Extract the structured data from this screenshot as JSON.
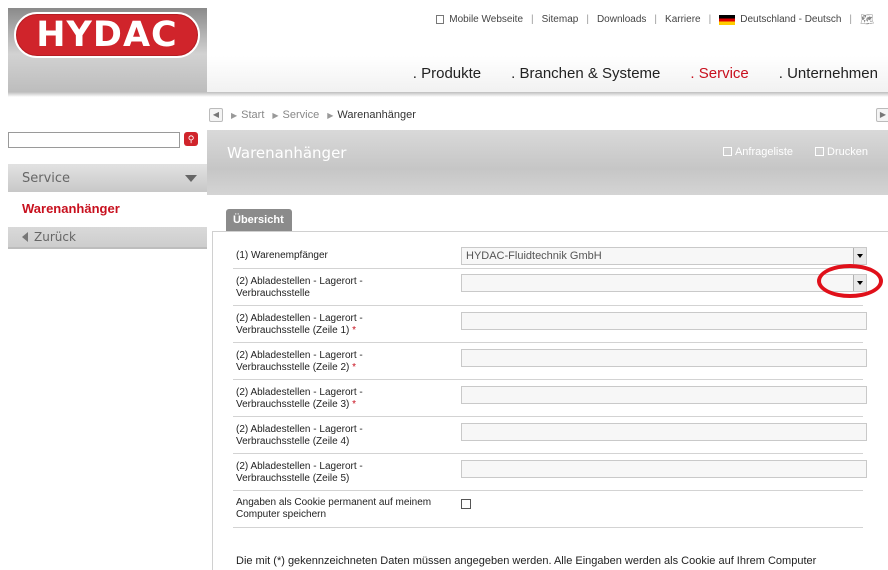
{
  "brand": {
    "logo_text": "HYDAC"
  },
  "topnav": {
    "mobile": "Mobile Webseite",
    "sitemap": "Sitemap",
    "downloads": "Downloads",
    "karriere": "Karriere",
    "country": "Deutschland - Deutsch"
  },
  "mainnav": {
    "produkte": ". Produkte",
    "branchen": ". Branchen & Systeme",
    "service": ". Service",
    "unternehmen": ". Unternehmen"
  },
  "breadcrumb": {
    "start": "Start",
    "service": "Service",
    "current": "Warenanhänger"
  },
  "sidebar": {
    "search_placeholder": "",
    "section": "Service",
    "active_item": "Warenanhänger",
    "back": "Zurück"
  },
  "page": {
    "title": "Warenanhänger",
    "anfrageliste": "Anfrageliste",
    "drucken": "Drucken",
    "tab": "Übersicht"
  },
  "form": {
    "r1_label": "(1) Warenempfänger",
    "r1_value": "HYDAC-Fluidtechnik GmbH",
    "r2_label_a": "(2) Abladestellen - Lagerort -",
    "r2_label_b": "Verbrauchsstelle",
    "r3_label_a": "(2) Abladestellen - Lagerort -",
    "r3_label_b": "Verbrauchsstelle (Zeile 1)",
    "r4_label_a": "(2) Abladestellen - Lagerort -",
    "r4_label_b": "Verbrauchsstelle (Zeile 2)",
    "r5_label_a": "(2) Abladestellen - Lagerort -",
    "r5_label_b": "Verbrauchsstelle (Zeile 3)",
    "r6_label_a": "(2) Abladestellen - Lagerort -",
    "r6_label_b": "Verbrauchsstelle (Zeile 4)",
    "r7_label_a": "(2) Abladestellen - Lagerort -",
    "r7_label_b": "Verbrauchsstelle (Zeile 5)",
    "required_mark": "*",
    "cookie_label_a": "Angaben als Cookie permanent auf meinem",
    "cookie_label_b": "Computer speichern",
    "note": "Die mit (*) gekennzeichneten Daten müssen angegeben werden. Alle Eingaben werden als Cookie auf Ihrem Computer"
  },
  "colors": {
    "brand_red": "#d0242b",
    "active_red": "#c8101e"
  }
}
